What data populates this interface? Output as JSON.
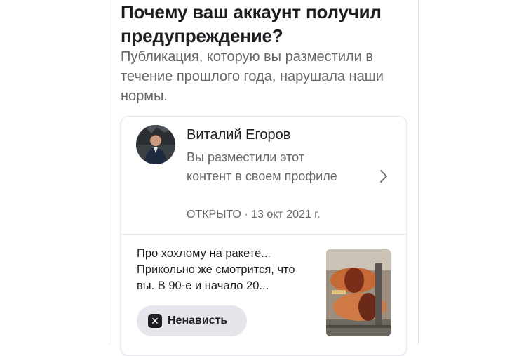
{
  "header": {
    "title": "Почему ваш аккаунт получил предупреждение?",
    "subtitle": "Публикация, которую вы разместили в течение прошлого года, нарушала наши нормы."
  },
  "post_card": {
    "author": "Виталий Егоров",
    "description": "Вы разместили этот контент в своем профиле",
    "meta": "ОТКРЫТО · 13 окт 2021 г.",
    "text": "Про хохлому на ракете... Прикольно же смотрится, что вы. В 90-е и начало 20...",
    "violation_tag": "Ненависть",
    "icons": {
      "chevron": "chevron-right-icon",
      "tag": "close-square-icon"
    }
  },
  "colors": {
    "text_primary": "#1c1e21",
    "text_secondary": "#65676b",
    "tag_background": "#e4e6eb",
    "border": "#e4e6eb"
  }
}
